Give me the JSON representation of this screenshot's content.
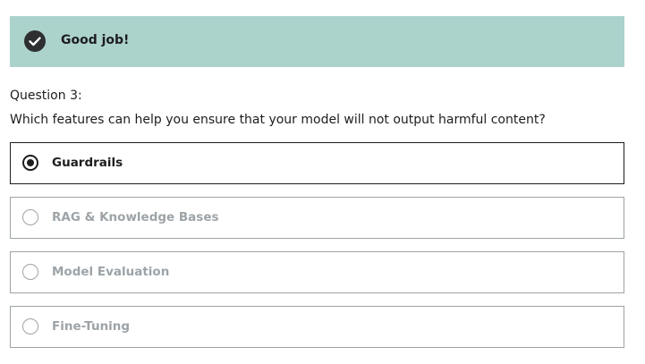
{
  "feedback": {
    "message": "Good job!",
    "icon": "check-circle-icon",
    "background_color": "#acd2cc"
  },
  "question": {
    "number_label": "Question 3:",
    "text": "Which features can help you ensure that your model will not output harmful content?"
  },
  "options": [
    {
      "label": "Guardrails",
      "selected": true
    },
    {
      "label": "RAG & Knowledge Bases",
      "selected": false
    },
    {
      "label": "Model Evaluation",
      "selected": false
    },
    {
      "label": "Fine-Tuning",
      "selected": false
    }
  ]
}
